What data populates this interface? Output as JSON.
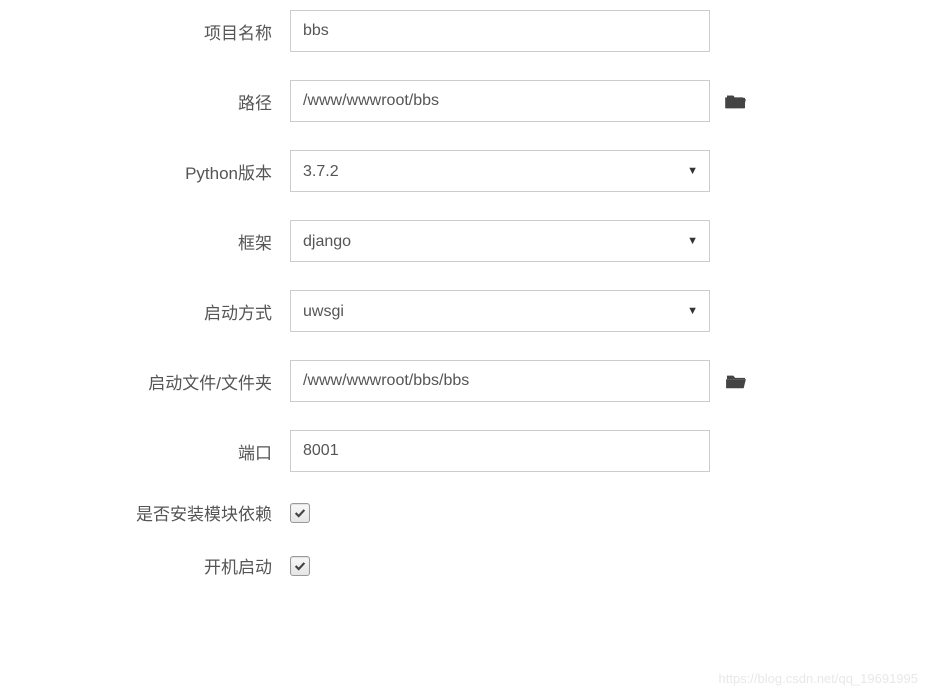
{
  "form": {
    "project_name": {
      "label": "项目名称",
      "value": "bbs"
    },
    "path": {
      "label": "路径",
      "value": "/www/wwwroot/bbs"
    },
    "python_version": {
      "label": "Python版本",
      "value": "3.7.2"
    },
    "framework": {
      "label": "框架",
      "value": "django"
    },
    "start_mode": {
      "label": "启动方式",
      "value": "uwsgi"
    },
    "start_file": {
      "label": "启动文件/文件夹",
      "value": "/www/wwwroot/bbs/bbs"
    },
    "port": {
      "label": "端口",
      "value": "8001"
    },
    "install_deps": {
      "label": "是否安装模块依赖",
      "checked": true
    },
    "boot_start": {
      "label": "开机启动",
      "checked": true
    }
  },
  "watermark": "https://blog.csdn.net/qq_19691995"
}
